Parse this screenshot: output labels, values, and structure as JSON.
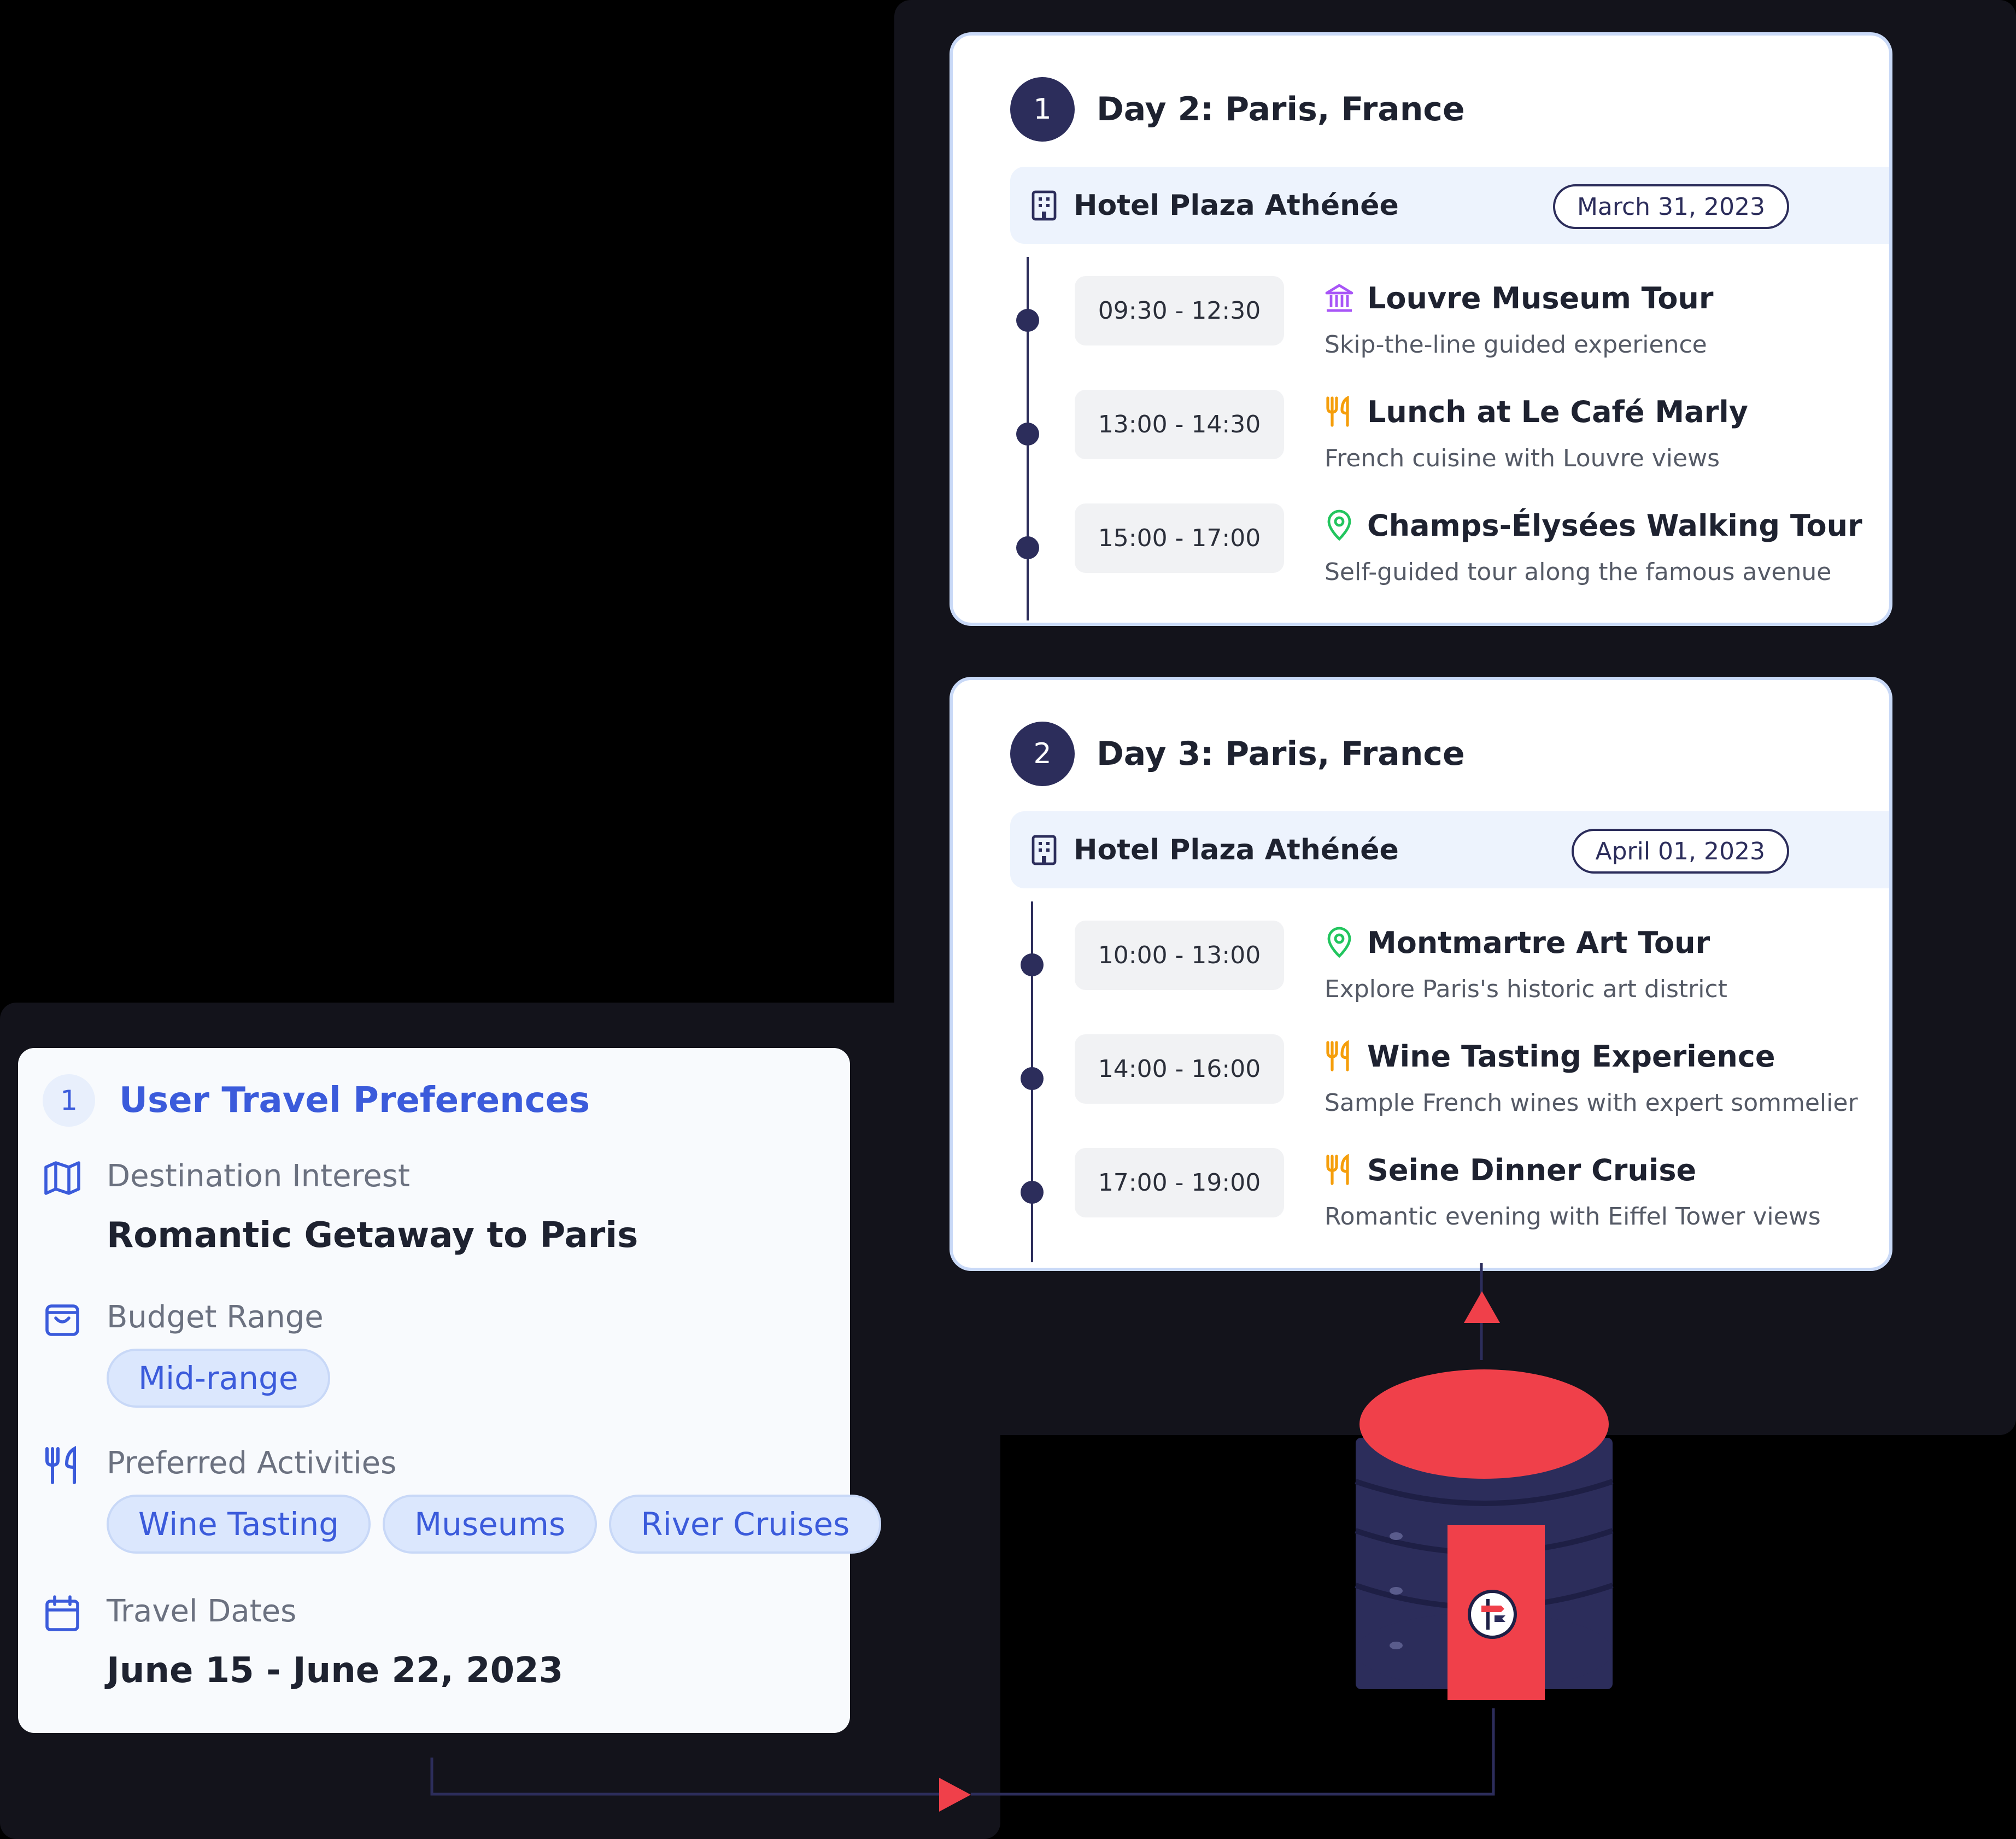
{
  "days": [
    {
      "number": "1",
      "title": "Day 2: Paris, France",
      "hotel": "Hotel Plaza Athénée",
      "date": "March 31, 2023",
      "activities": [
        {
          "time": "09:30 - 12:30",
          "title": "Louvre Museum Tour",
          "description": "Skip-the-line guided experience",
          "icon": "museum-icon",
          "icon_color": "#a855f7"
        },
        {
          "time": "13:00 - 14:30",
          "title": "Lunch at Le Café Marly",
          "description": "French cuisine with Louvre views",
          "icon": "utensils-icon",
          "icon_color": "#f59e0b"
        },
        {
          "time": "15:00 - 17:00",
          "title": "Champs-Élysées Walking Tour",
          "description": "Self-guided tour along the famous avenue",
          "icon": "map-pin-icon",
          "icon_color": "#22c55e"
        }
      ]
    },
    {
      "number": "2",
      "title": "Day 3: Paris, France",
      "hotel": "Hotel Plaza Athénée",
      "date": "April 01, 2023",
      "activities": [
        {
          "time": "10:00 - 13:00",
          "title": "Montmartre Art Tour",
          "description": "Explore Paris's historic art district",
          "icon": "map-pin-icon",
          "icon_color": "#22c55e"
        },
        {
          "time": "14:00 - 16:00",
          "title": "Wine Tasting Experience",
          "description": "Sample French wines with expert sommelier",
          "icon": "utensils-icon",
          "icon_color": "#f59e0b"
        },
        {
          "time": "17:00 - 19:00",
          "title": "Seine Dinner Cruise",
          "description": "Romantic evening with Eiffel Tower views",
          "icon": "utensils-icon",
          "icon_color": "#f59e0b"
        }
      ]
    }
  ],
  "preferences": {
    "number": "1",
    "title": "User Travel Preferences",
    "destination": {
      "label": "Destination Interest",
      "value": "Romantic Getaway to Paris",
      "icon": "map-icon"
    },
    "budget": {
      "label": "Budget Range",
      "tags": [
        "Mid-range"
      ],
      "icon": "shopping-bag-icon"
    },
    "activities": {
      "label": "Preferred Activities",
      "tags": [
        "Wine Tasting",
        "Museums",
        "River Cruises"
      ],
      "icon": "utensils-icon"
    },
    "dates": {
      "label": "Travel Dates",
      "value": "June 15 - June 22, 2023",
      "icon": "calendar-icon"
    }
  },
  "colors": {
    "navy": "#2c2d5b",
    "accent_blue": "#3b5bdb",
    "arrow_red": "#f0404a",
    "card_border": "#c9d9f7",
    "tag_bg": "#dbe7fd"
  }
}
